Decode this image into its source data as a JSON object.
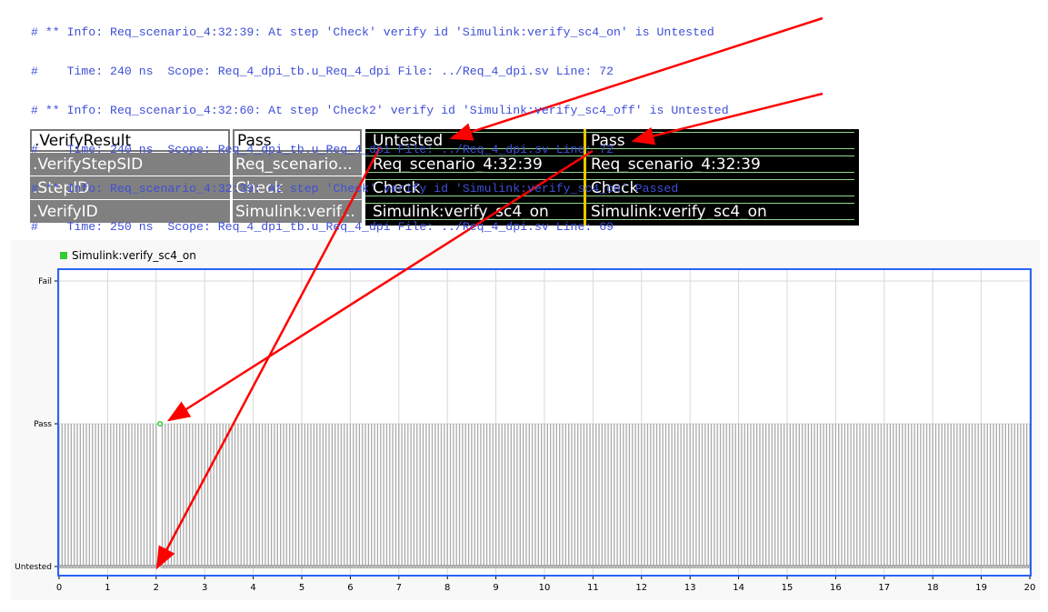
{
  "log_lines": [
    "# ** Info: Req_scenario_4:32:39: At step 'Check' verify id 'Simulink:verify_sc4_on' is Untested",
    "#    Time: 240 ns  Scope: Req_4_dpi_tb.u_Req_4_dpi File: ../Req_4_dpi.sv Line: 72",
    "# ** Info: Req_scenario_4:32:60: At step 'Check2' verify id 'Simulink:verify_sc4_off' is Untested",
    "#    Time: 240 ns  Scope: Req_4_dpi_tb.u_Req_4_dpi File: ../Req_4_dpi.sv Line: 72",
    "# ** Info: Req_scenario_4:32:39: At step 'Check' verify id 'Simulink:verify_sc4_on' Passed",
    "#    Time: 250 ns  Scope: Req_4_dpi_tb.u_Req_4_dpi File: ../Req_4_dpi.sv Line: 69"
  ],
  "wave": {
    "signals": [
      {
        "name": ".VerifyResult",
        "value": "Pass",
        "before": "Untested",
        "after": "Pass"
      },
      {
        "name": ".VerifyStepSID",
        "value": "Req_scenario...",
        "before": "Req_scenario_4:32:39",
        "after": "Req_scenario_4:32:39"
      },
      {
        "name": ".StepID",
        "value": "Check",
        "before": "Check",
        "after": "Check"
      },
      {
        "name": ".VerifyID",
        "value": "Simulink:verif...",
        "before": "Simulink:verify_sc4_on",
        "after": "Simulink:verify_sc4_on"
      }
    ]
  },
  "chart_data": {
    "type": "scatter",
    "legend": [
      "Simulink:verify_sc4_on"
    ],
    "legend_color": "#33cc33",
    "y_categories": [
      "Untested",
      "Pass",
      "Fail"
    ],
    "xlim": [
      0,
      20
    ],
    "x_ticks": [
      "0",
      "1",
      "2",
      "3",
      "4",
      "5",
      "6",
      "7",
      "8",
      "9",
      "10",
      "11",
      "12",
      "13",
      "14",
      "15",
      "16",
      "17",
      "18",
      "19",
      "20"
    ],
    "sample_step": 0.0625,
    "pass_at": 2.08,
    "default_value": "Untested",
    "stem_color": "#aaaaaa",
    "frame_color": "#2a63f5"
  }
}
